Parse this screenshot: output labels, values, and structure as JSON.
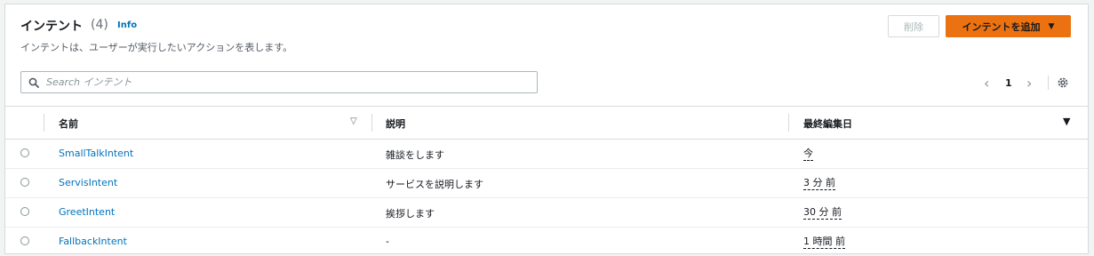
{
  "header": {
    "title": "インテント",
    "count": "(4)",
    "info_link": "Info",
    "description": "インテントは、ユーザーが実行したいアクションを表します。"
  },
  "actions": {
    "delete_label": "削除",
    "add_label": "インテントを追加"
  },
  "search": {
    "placeholder": "Search インテント",
    "value": ""
  },
  "pagination": {
    "current_page": "1"
  },
  "table": {
    "columns": [
      "名前",
      "説明",
      "最終編集日"
    ],
    "rows": [
      {
        "name": "SmallTalkIntent",
        "description": "雑談をします",
        "last_edited": "今"
      },
      {
        "name": "ServisIntent",
        "description": "サービスを説明します",
        "last_edited": "3 分 前"
      },
      {
        "name": "GreetIntent",
        "description": "挨拶します",
        "last_edited": "30 分 前"
      },
      {
        "name": "FallbackIntent",
        "description": "-",
        "last_edited": "1 時間 前"
      }
    ]
  },
  "colors": {
    "accent": "#ec7211",
    "link": "#0073bb"
  },
  "icons": [
    "search-icon",
    "chevron-left-icon",
    "chevron-right-icon",
    "settings-icon",
    "caret-down-icon",
    "sort-icon",
    "sort-descending-icon"
  ]
}
